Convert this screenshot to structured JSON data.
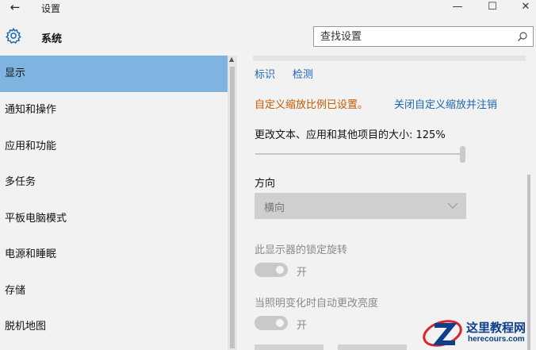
{
  "window": {
    "back_glyph": "←",
    "title": "设置",
    "minimize_glyph": "—",
    "maximize_glyph": "☐",
    "close_glyph": "✕"
  },
  "header": {
    "gear_icon": "gear-icon",
    "app_name": "系统",
    "search_placeholder": "查找设置",
    "search_icon": "search-icon"
  },
  "sidebar": {
    "items": [
      {
        "label": "显示",
        "active": true
      },
      {
        "label": "通知和操作",
        "active": false
      },
      {
        "label": "应用和功能",
        "active": false
      },
      {
        "label": "多任务",
        "active": false
      },
      {
        "label": "平板电脑模式",
        "active": false
      },
      {
        "label": "电源和睡眠",
        "active": false
      },
      {
        "label": "存储",
        "active": false
      },
      {
        "label": "脱机地图",
        "active": false
      }
    ]
  },
  "main": {
    "identify_link": "标识",
    "detect_link": "检测",
    "custom_scale_warning": "自定义缩放比例已设置。",
    "disable_custom_scale_link": "关闭自定义缩放并注销",
    "scale_label": "更改文本、应用和其他项目的大小: 125%",
    "scale_value_percent": 100,
    "orientation_label": "方向",
    "orientation_value": "横向",
    "rotation_lock_label": "此显示器的锁定旋转",
    "rotation_lock_state": "开",
    "auto_brightness_label": "当照明变化时自动更改亮度",
    "auto_brightness_state": "开"
  },
  "watermark": {
    "title": "这里教程网",
    "url": "herecours.com"
  },
  "colors": {
    "accent": "#7fb4e0",
    "link": "#1a66b3",
    "warning": "#c85a00",
    "background": "#f2f2f2"
  }
}
